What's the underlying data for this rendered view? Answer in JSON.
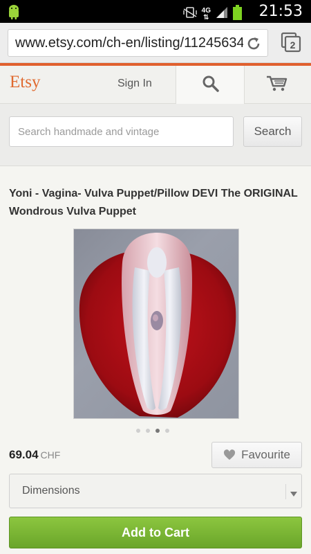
{
  "status_bar": {
    "network": "4G",
    "time": "21:53",
    "icons": [
      "android-icon",
      "mute-vibrate-icon",
      "signal-icon",
      "battery-icon"
    ]
  },
  "browser": {
    "url": "www.etsy.com/ch-en/listing/11245634",
    "tab_count": "2"
  },
  "header": {
    "logo": "Etsy",
    "sign_in": "Sign In",
    "icons": [
      "search-icon",
      "cart-icon"
    ]
  },
  "search": {
    "placeholder": "Search handmade and vintage",
    "button": "Search"
  },
  "listing": {
    "title": "Yoni - Vagina- Vulva Puppet/Pillow DEVI The ORIGINAL Wondrous Vulva Puppet",
    "image_count": 4,
    "active_image": 3,
    "price": "69.04",
    "currency": "CHF",
    "favourite_label": "Favourite",
    "dimensions_select": "Dimensions",
    "add_to_cart": "Add to Cart"
  },
  "colors": {
    "accent": "#e0602e",
    "cart_green": "#7cb935"
  }
}
